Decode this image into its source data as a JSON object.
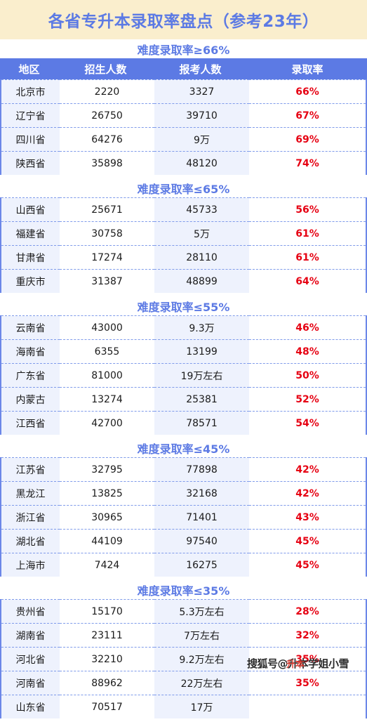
{
  "title": "各省专升本录取率盘点（参考23年）",
  "columns": [
    "地区",
    "招生人数",
    "报考人数",
    "录取率"
  ],
  "accent_blue": "#5c7ae4",
  "title_bg": "#faeecd",
  "rate_red": "#e60012",
  "row_tint": "#eef2fd",
  "watermark": {
    "text": "搜狐号@升本学姐小雪",
    "overlay": "升本"
  },
  "sections": [
    {
      "heading": "难度录取率≥66%",
      "rows": [
        {
          "region": "北京市",
          "enroll": "2220",
          "apply": "3327",
          "rate": "66%"
        },
        {
          "region": "辽宁省",
          "enroll": "26750",
          "apply": "39710",
          "rate": "67%"
        },
        {
          "region": "四川省",
          "enroll": "64276",
          "apply": "9万",
          "rate": "69%"
        },
        {
          "region": "陕西省",
          "enroll": "35898",
          "apply": "48120",
          "rate": "74%"
        }
      ]
    },
    {
      "heading": "难度录取率≤65%",
      "rows": [
        {
          "region": "山西省",
          "enroll": "25671",
          "apply": "45733",
          "rate": "56%"
        },
        {
          "region": "福建省",
          "enroll": "30758",
          "apply": "5万",
          "rate": "61%"
        },
        {
          "region": "甘肃省",
          "enroll": "17274",
          "apply": "28110",
          "rate": "61%"
        },
        {
          "region": "重庆市",
          "enroll": "31387",
          "apply": "48899",
          "rate": "64%"
        }
      ]
    },
    {
      "heading": "难度录取率≤55%",
      "rows": [
        {
          "region": "云南省",
          "enroll": "43000",
          "apply": "9.3万",
          "rate": "46%"
        },
        {
          "region": "海南省",
          "enroll": "6355",
          "apply": "13199",
          "rate": "48%"
        },
        {
          "region": "广东省",
          "enroll": "81000",
          "apply": "19万左右",
          "rate": "50%"
        },
        {
          "region": "内蒙古",
          "enroll": "13274",
          "apply": "25381",
          "rate": "52%"
        },
        {
          "region": "江西省",
          "enroll": "42700",
          "apply": "78571",
          "rate": "54%"
        }
      ]
    },
    {
      "heading": "难度录取率≤45%",
      "rows": [
        {
          "region": "江苏省",
          "enroll": "32795",
          "apply": "77898",
          "rate": "42%"
        },
        {
          "region": "黑龙江",
          "enroll": "13825",
          "apply": "32168",
          "rate": "42%"
        },
        {
          "region": "浙江省",
          "enroll": "30965",
          "apply": "71401",
          "rate": "43%"
        },
        {
          "region": "湖北省",
          "enroll": "44109",
          "apply": "97540",
          "rate": "45%"
        },
        {
          "region": "上海市",
          "enroll": "7424",
          "apply": "16275",
          "rate": "45%"
        }
      ]
    },
    {
      "heading": "难度录取率≤35%",
      "rows": [
        {
          "region": "贵州省",
          "enroll": "15170",
          "apply": "5.3万左右",
          "rate": "28%"
        },
        {
          "region": "湖南省",
          "enroll": "23111",
          "apply": "7万左右",
          "rate": "32%"
        },
        {
          "region": "河北省",
          "enroll": "32210",
          "apply": "9.2万左右",
          "rate": "35%"
        },
        {
          "region": "河南省",
          "enroll": "88962",
          "apply": "22万左右",
          "rate": "35%"
        },
        {
          "region": "山东省",
          "enroll": "70517",
          "apply": "17万",
          "rate": ""
        }
      ]
    }
  ]
}
